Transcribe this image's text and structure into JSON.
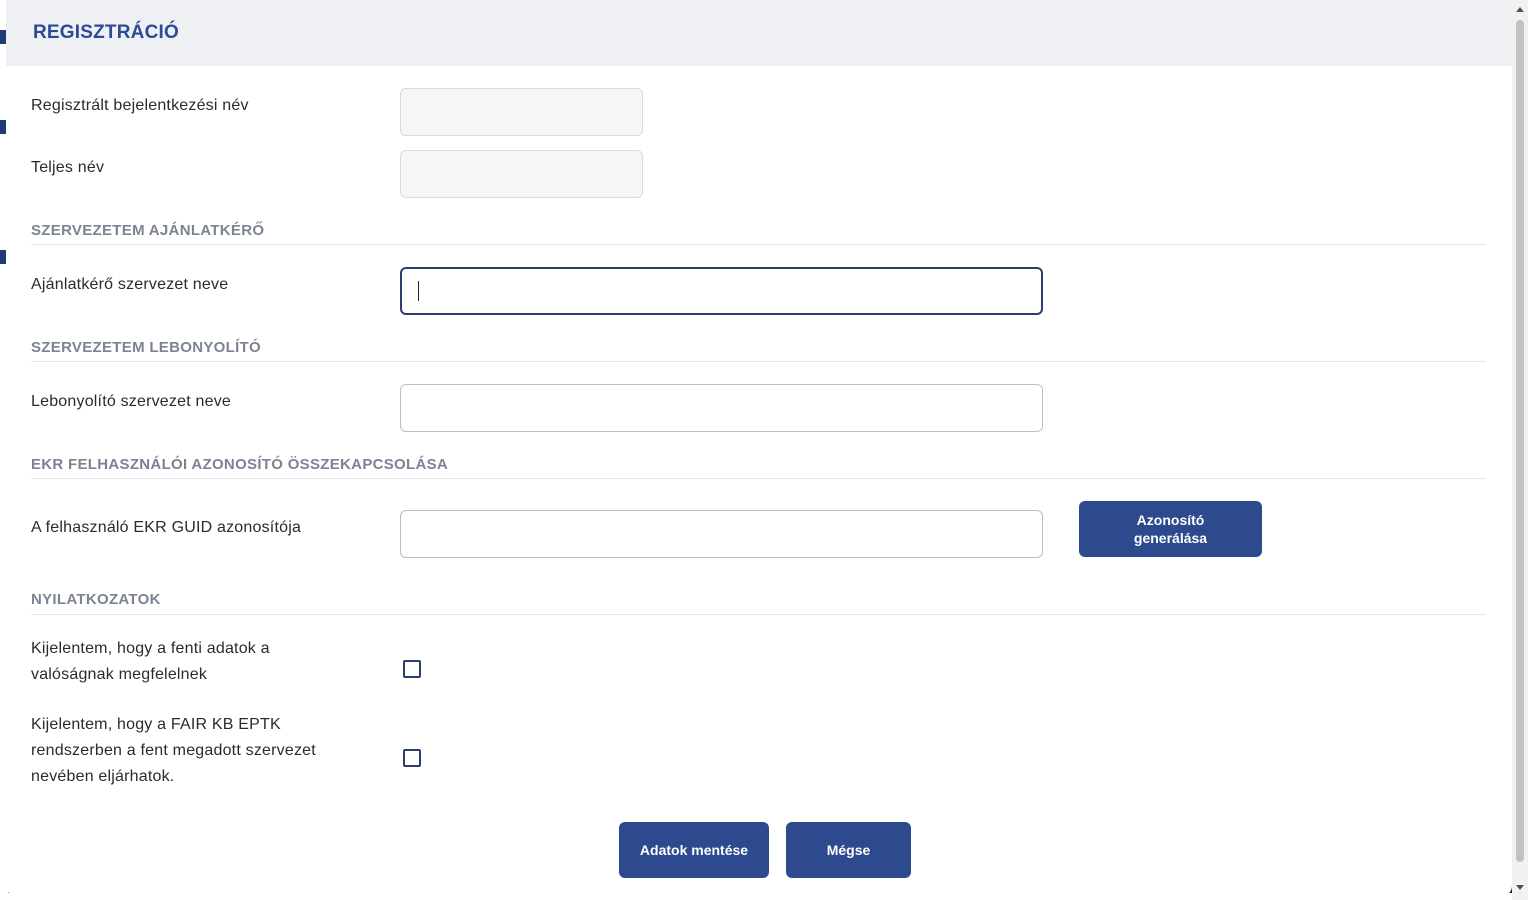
{
  "modal": {
    "title": "REGISZTRÁCIÓ"
  },
  "fields": {
    "login_name": {
      "label": "Regisztrált bejelentkezési név",
      "value": ""
    },
    "full_name": {
      "label": "Teljes név",
      "value": ""
    }
  },
  "sections": {
    "requester": {
      "title": "SZERVEZETEM AJÁNLATKÉRŐ",
      "field_label": "Ajánlatkérő szervezet neve",
      "value": ""
    },
    "organizer": {
      "title": "SZERVEZETEM LEBONYOLÍTÓ",
      "field_label": "Lebonyolító szervezet neve",
      "value": ""
    },
    "ekr": {
      "title": "EKR FELHASZNÁLÓI AZONOSÍTÓ ÖSSZEKAPCSOLÁSA",
      "field_label": "A felhasználó EKR GUID azonosítója",
      "value": "",
      "generate_button_line1": "Azonosító",
      "generate_button_line2": "generálása"
    },
    "declarations": {
      "title": "NYILATKOZATOK",
      "decl1_line1": "Kijelentem, hogy a fenti adatok a",
      "decl1_line2": "valóságnak megfelelnek",
      "decl1_checked": false,
      "decl2_line1": "Kijelentem, hogy a FAIR KB EPTK",
      "decl2_line2": "rendszerben a fent megadott szervezet",
      "decl2_line3": "nevében eljárhatok.",
      "decl2_checked": false
    }
  },
  "footer": {
    "save_label": "Adatok mentése",
    "cancel_label": "Mégse"
  },
  "colors": {
    "accent": "#2d4a8f",
    "title": "#2c4a97",
    "section_title": "#7c8393",
    "header_bg": "#eff0f3"
  }
}
